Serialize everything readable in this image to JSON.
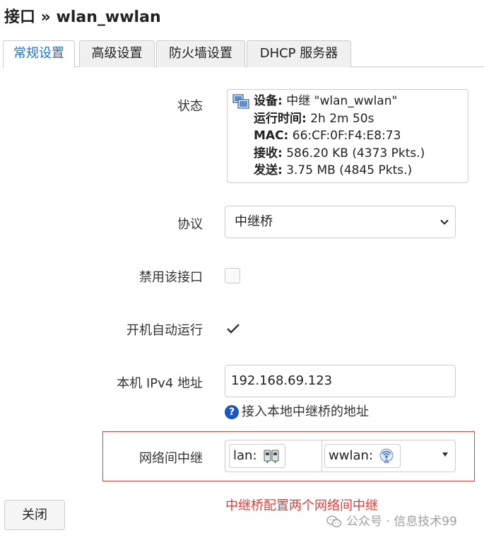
{
  "page": {
    "title": "接口 » wlan_wwlan"
  },
  "tabs": [
    {
      "label": "常规设置",
      "active": true
    },
    {
      "label": "高级设置",
      "active": false
    },
    {
      "label": "防火墙设置",
      "active": false
    },
    {
      "label": "DHCP 服务器",
      "active": false
    }
  ],
  "status": {
    "label": "状态",
    "device_key": "设备:",
    "device_val": " 中继 \"wlan_wwlan\"",
    "uptime_key": "运行时间:",
    "uptime_val": " 2h 2m 50s",
    "mac_key": "MAC:",
    "mac_val": " 66:CF:0F:F4:E8:73",
    "rx_key": "接收:",
    "rx_val": " 586.20 KB (4373 Pkts.)",
    "tx_key": "发送:",
    "tx_val": " 3.75 MB (4845 Pkts.)"
  },
  "protocol": {
    "label": "协议",
    "value": "中继桥"
  },
  "disable": {
    "label": "禁用该接口",
    "checked": false
  },
  "autostart": {
    "label": "开机自动运行",
    "checked": true
  },
  "ipv4": {
    "label": "本机 IPv4 地址",
    "value": "192.168.69.123",
    "help": "接入本地中继桥的地址",
    "help_icon": "?"
  },
  "relay": {
    "label": "网络间中继",
    "chips": [
      {
        "label": "lan:",
        "icon": "ethernet-switch-icon"
      },
      {
        "label": "wwlan:",
        "icon": "wireless-icon"
      }
    ]
  },
  "annotation": "中继桥配置两个网络间中继",
  "close_button": "关闭",
  "watermark": "公众号 · 信息技术99",
  "colors": {
    "active_tab": "#1a73c7",
    "annotation": "#e53935",
    "help_icon": "#1a56c7"
  }
}
